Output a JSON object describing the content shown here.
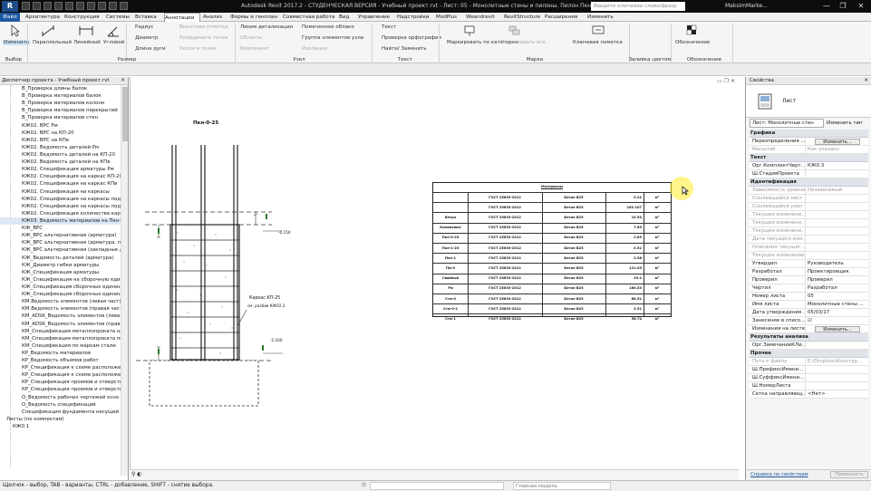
{
  "titlebar": {
    "logo": "R",
    "title": "Autodesk Revit 2017.2 - СТУДЕНЧЕСКАЯ ВЕРСИЯ -   Учебный проект.rvt - Лист: 05 - Монолитные стены и пилоны. Пилон Пкн-0-25",
    "search_placeholder": "Введите ключевое слово/фразу",
    "user": "MaksimMarke...",
    "controls": [
      "—",
      "❐",
      "✕"
    ]
  },
  "tabs": [
    "Файл",
    "Архитектура",
    "Конструкция",
    "Системы",
    "Вставка",
    "Аннотации",
    "Анализ",
    "Формы и генплан",
    "Совместная работа",
    "Вид",
    "Управление",
    "Надстройки",
    "ModPlus",
    "Weandrevit",
    "RevitStructure",
    "Расширения",
    "Изменить"
  ],
  "active_tab": "Аннотации",
  "ribbon": {
    "modify": "Изменить",
    "dims": [
      "Параллельный",
      "Линейный",
      "Угловой"
    ],
    "dims_small": [
      "Радиус",
      "Диаметр",
      "Длина дуги"
    ],
    "spot": [
      "Высотная отметка",
      "Уклон в точке",
      "Координата точки"
    ],
    "detail": [
      "Линия детализации",
      "Область",
      "Компонент",
      "Изоляция",
      "Помеченное облако",
      "Группа элементов узла"
    ],
    "text": [
      "Текст",
      "Проверка орфографии",
      "Найти/ Заменить"
    ],
    "tag": [
      "Маркировать по категории",
      "Маркировать все",
      "Ключевая пометка"
    ],
    "symbol": "Обозначение",
    "panels": [
      "Выбор",
      "Размер",
      "Узел",
      "Текст",
      "Марка",
      "Заливка цветом",
      "Обозначение"
    ]
  },
  "project_browser": {
    "title": "Диспетчер проекта - Учебный проект.rvt",
    "items": [
      "В_Проверка длины балок",
      "В_Проверка материалов балок",
      "В_Проверка материалов колонн",
      "В_Проверка материалов перекрытий",
      "В_Проверка материалов стен",
      "КЖ02. ВРС Рм",
      "КЖ02. ВРС на КП-20",
      "КЖ02. ВРС на КПв",
      "КЖ02. Ведомость деталей Рм",
      "КЖ02. Ведомость деталей на КП-20",
      "КЖ02. Ведомость деталей на КПв",
      "КЖ02. Спецификация арматуры Рм",
      "КЖ02. Спецификация на каркас КП-20",
      "КЖ02. Спецификация на каркас КПв",
      "КЖ02. Спецификация на каркасы",
      "КЖ02. Спецификация на каркасы под к",
      "КЖ02. Спецификация на каркасы под к",
      "КЖ02. Спецификация количества каркас",
      "КЖ03. Ведомость материалов на Пкн-0",
      "КЖ_ВРС",
      "КЖ_ВРС альтернативная (арматура)",
      "КЖ_ВРС альтернативная (арматура, пр",
      "КЖ_ВРС альтернативная (закладные д",
      "КЖ_Ведомость деталей (арматура)",
      "КЖ_Диаметр гибки арматуры",
      "КЖ_Спецификация арматуры",
      "КЖ_Спецификация на сборочную един",
      "КЖ_Спецификация сборочных единиц",
      "КЖ_Спецификация сборочных единиц",
      "КМ.Ведомость элементов (левая част)",
      "КМ.Ведомость элементов (правая част)",
      "КМ_ADSK_Ведомость элементов (левая",
      "КМ_ADSK_Ведомость элементов (прав",
      "КМ_Спецификация металлопроката на",
      "КМ_Спецификация металлопроката по",
      "КМ_Спецификация по маркам стали",
      "КР_Ведомость материалов",
      "КР_Ведомость объемов работ",
      "КР_Спецификация к схеме расположен",
      "КР_Спецификация к схеме расположен",
      "КР_Спецификация проемов и отверсти",
      "КР_Спецификация проемов и отверсти",
      "О_Ведомость рабочих чертежей осно",
      "О_Ведомость спецификаций",
      "Спецификация фундамента несущей к",
      "Листы (по компектам)",
      "КЖ0.1"
    ],
    "selected": 18
  },
  "drawing": {
    "title": "Пкн-0-25",
    "elev_top": "-0.150",
    "elev_bottom": "-2.100",
    "cage": "Каркас КП-25",
    "cage_ref": "см. разбив КЖ02.2"
  },
  "table": {
    "header": "Материалы",
    "rows": [
      {
        "a": "",
        "b": "ГОСТ 25633-2012",
        "c": "Бетон В25",
        "d": "0.22",
        "u": "м³"
      },
      {
        "a": "",
        "b": "ГОСТ 25633-2012",
        "c": "Бетон В25",
        "d": "162.107",
        "u": "м³"
      },
      {
        "a": "Ветра",
        "b": "ГОСТ 25633-2012",
        "c": "Бетон В25",
        "d": "10.53",
        "u": "м³"
      },
      {
        "a": "Калиновые",
        "b": "ГОСТ 25633-2012",
        "c": "Бетон В25",
        "d": "7.85",
        "u": "м³"
      },
      {
        "a": "Пкн-0-25",
        "b": "ГОСТ 25633-2012",
        "c": "Бетон В25",
        "d": "2.85",
        "u": "м³"
      },
      {
        "a": "Пкн-1-25",
        "b": "ГОСТ 25633-2012",
        "c": "Бетон В25",
        "d": "0.52",
        "u": "м³"
      },
      {
        "a": "Пкн-1",
        "b": "ГОСТ 25633-2012",
        "c": "Бетон В25",
        "d": "3.58",
        "u": "м³"
      },
      {
        "a": "Пм-0",
        "b": "ГОСТ 25633-2012",
        "c": "Бетон В25",
        "d": "121.05",
        "u": "м³"
      },
      {
        "a": "Свайный",
        "b": "ГОСТ 25633-2012",
        "c": "Бетон В25",
        "d": "29.2",
        "u": "м³"
      },
      {
        "a": "Рм",
        "b": "ГОСТ 25633-2012",
        "c": "Бетон В25",
        "d": "160.53",
        "u": "м³"
      },
      {
        "a": "Стм-0",
        "b": "ГОСТ 25633-2012",
        "c": "Бетон В25",
        "d": "66.51",
        "u": "м³"
      },
      {
        "a": "Стм-0-2",
        "b": "ГОСТ 25633-2012",
        "c": "Бетон В25",
        "d": "3.51",
        "u": "м³"
      },
      {
        "a": "Стм-1",
        "b": "ГОСТ 25633-2012",
        "c": "Бетон В25",
        "d": "36.74",
        "u": "м³"
      }
    ]
  },
  "properties": {
    "title": "Свойства",
    "type": "Лист",
    "selector": "Лист: Монолитные стен",
    "edit_type": "Изменить тип",
    "rows": [
      {
        "cat": "Графика"
      },
      {
        "k": "Переопределения ...",
        "btn": "Изменить..."
      },
      {
        "k": "Масштаб",
        "v": "Как указано",
        "ro": true
      },
      {
        "cat": "Текст"
      },
      {
        "k": "Орг.КомплектЧерт...",
        "v": "КЖ0.3"
      },
      {
        "k": "Ш.СтадияПроекта",
        "v": ""
      },
      {
        "cat": "Идентификация"
      },
      {
        "k": "Зависимость уровня",
        "v": "Независимый",
        "ro": true
      },
      {
        "k": "Ссылающийся лист",
        "v": "",
        "ro": true
      },
      {
        "k": "Ссылающийся узел",
        "v": "",
        "ro": true
      },
      {
        "k": "Текущее изменени...",
        "v": "",
        "ro": true
      },
      {
        "k": "Текущее изменени...",
        "v": "",
        "ro": true
      },
      {
        "k": "Текущее изменени...",
        "v": "",
        "ro": true
      },
      {
        "k": "Дата текущего изм...",
        "v": "",
        "ro": true
      },
      {
        "k": "Описание текущег...",
        "v": "",
        "ro": true
      },
      {
        "k": "Текущее изменение",
        "v": "",
        "ro": true
      },
      {
        "k": "Утвердил",
        "v": "Руководитель"
      },
      {
        "k": "Разработал",
        "v": "Проектировщик"
      },
      {
        "k": "Проверил",
        "v": "Проверил"
      },
      {
        "k": "Чертил",
        "v": "Разработал"
      },
      {
        "k": "Номер листа",
        "v": "05"
      },
      {
        "k": "Имя листа",
        "v": "Монолитные стены ..."
      },
      {
        "k": "Дата утверждения ...",
        "v": "05/03/17"
      },
      {
        "k": "Занесение в списо...",
        "v": "☑"
      },
      {
        "k": "Изменения на листе",
        "btn": "Изменить..."
      },
      {
        "cat": "Результаты анализа"
      },
      {
        "k": "Орг.ЗамечаниеКЛи...",
        "v": ""
      },
      {
        "cat": "Прочее"
      },
      {
        "k": "Путь к файлу",
        "v": "E:\\Dropbox\\Констру...",
        "ro": true
      },
      {
        "k": "Ш.ПрефиксИмени...",
        "v": ""
      },
      {
        "k": "Ш.СуффиксИмени...",
        "v": ""
      },
      {
        "k": "Ш.НомерЛиста",
        "v": ""
      },
      {
        "k": "Сетка направляющ...",
        "v": "<Нет>"
      }
    ],
    "help": "Справка по свойствам",
    "apply": "Применить"
  },
  "status": {
    "hint": "Щелчок - выбор, TAB - варианты, CTRL - добавление, SHIFT - снятие выбора.",
    "model": "Главная модель",
    "zero": ":0"
  }
}
